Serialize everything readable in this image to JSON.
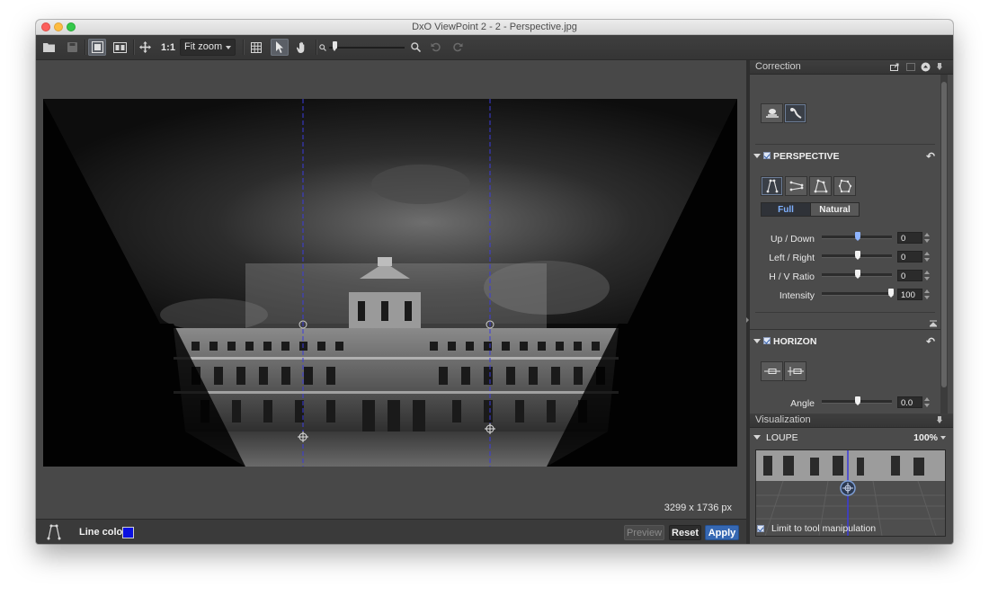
{
  "window": {
    "title": "DxO ViewPoint 2 - 2 - Perspective.jpg"
  },
  "toolbar": {
    "ratio_label": "1:1",
    "zoom_select": "Fit zoom"
  },
  "viewer": {
    "image_dimensions": "3299 x 1736 px",
    "line_color_label": "Line color",
    "line_color": "#0a10e0",
    "guide_line_color": "#3b3bdc"
  },
  "footer": {
    "preview_label": "Preview",
    "reset_label": "Reset",
    "apply_label": "Apply"
  },
  "correction_panel": {
    "header": "Correction",
    "perspective": {
      "title": "PERSPECTIVE",
      "modes": [
        "vertical-lines",
        "horizontal-lines",
        "rectangle",
        "eight-points"
      ],
      "segments": {
        "full": "Full",
        "natural": "Natural",
        "selected": "Full"
      },
      "sliders": [
        {
          "label": "Up / Down",
          "value": "0",
          "level": 0.5
        },
        {
          "label": "Left / Right",
          "value": "0",
          "level": 0.5
        },
        {
          "label": "H / V Ratio",
          "value": "0",
          "level": 0.5
        },
        {
          "label": "Intensity",
          "value": "100",
          "level": 1.0
        }
      ]
    },
    "horizon": {
      "title": "HORIZON",
      "sliders": [
        {
          "label": "Angle",
          "value": "0.0",
          "level": 0.5
        }
      ]
    }
  },
  "visualization_panel": {
    "header": "Visualization",
    "loupe": {
      "title": "LOUPE",
      "zoom": "100%"
    },
    "limit_label": "Limit to tool manipulation"
  },
  "colors": {
    "accent": "#3668b3",
    "background": "#4a4a4a",
    "panel_header": "#3a3a3a"
  }
}
